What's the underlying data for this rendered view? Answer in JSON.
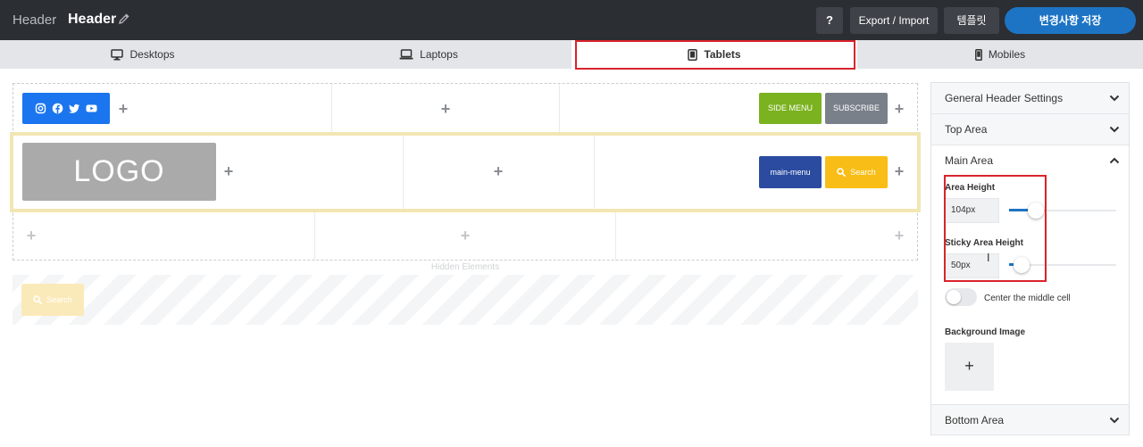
{
  "topbar": {
    "crumb": "Header",
    "title": "Header",
    "help_label": "?",
    "export_label": "Export / Import",
    "template_label": "템플릿",
    "save_label": "변경사항 저장"
  },
  "device_tabs": {
    "desktops": "Desktops",
    "laptops": "Laptops",
    "tablets": "Tablets",
    "mobiles": "Mobiles",
    "active": "Tablets"
  },
  "builder": {
    "top_row": {
      "social_icons": [
        "instagram-icon",
        "facebook-icon",
        "twitter-icon",
        "youtube-icon"
      ],
      "side_menu_label": "SIDE MENU",
      "subscribe_label": "SUBSCRIBE"
    },
    "main_row": {
      "logo_label": "LOGO",
      "main_menu_label": "main-menu",
      "search_label": "Search"
    },
    "add_symbol": "+",
    "hidden_elements_label": "Hidden Elements",
    "hidden_search_label": "Search"
  },
  "panel": {
    "general_label": "General Header Settings",
    "top_area_label": "Top Area",
    "main_area_label": "Main Area",
    "area_height_label": "Area Height",
    "area_height_value": "104px",
    "area_height_level": 0.25,
    "sticky_height_label": "Sticky Area Height",
    "sticky_height_value": "50px",
    "sticky_height_level": 0.12,
    "center_middle_label": "Center the middle cell",
    "center_middle_on": false,
    "bg_image_label": "Background Image",
    "bg_add_symbol": "+",
    "bottom_area_label": "Bottom Area"
  },
  "colors": {
    "topbar_bg": "#2b2e33",
    "primary_blue": "#1e74c4",
    "highlight_red": "#d9242b",
    "main_area_outline": "#f2e6b3"
  }
}
